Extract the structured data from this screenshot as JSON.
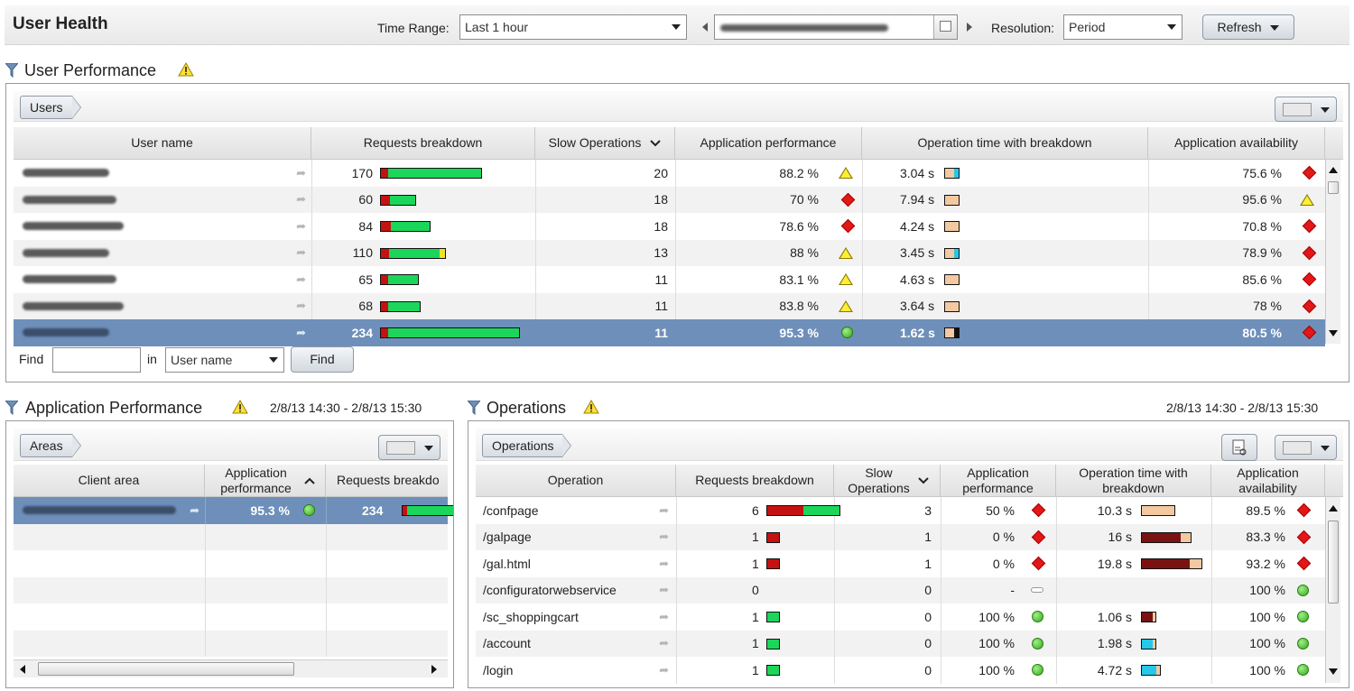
{
  "header": {
    "title": "User Health",
    "time_range_label": "Time Range:",
    "time_range_value": "Last 1 hour",
    "resolution_label": "Resolution:",
    "resolution_value": "Period",
    "refresh_label": "Refresh"
  },
  "user_performance": {
    "title": "User Performance",
    "breadcrumb": "Users",
    "columns": [
      "User name",
      "Requests breakdown",
      "Slow Operations",
      "Application performance",
      "Operation time with breakdown",
      "Application availability"
    ],
    "rows": [
      {
        "requests": "170",
        "req_red": 0.07,
        "req_green": 0.93,
        "req_yellow": 0,
        "slow": "20",
        "perf": "88.2 %",
        "perf_icon": "warning-triangle-icon",
        "optime": "3.04 s",
        "ot": [
          "peach",
          "cyan"
        ],
        "avail": "75.6 %",
        "avail_icon": "red-diamond-icon",
        "bar_total": 170
      },
      {
        "requests": "60",
        "req_red": 0.25,
        "req_green": 0.75,
        "req_yellow": 0,
        "slow": "18",
        "perf": "70 %",
        "perf_icon": "red-diamond-icon",
        "optime": "7.94 s",
        "ot": [
          "peach"
        ],
        "avail": "95.6 %",
        "avail_icon": "warning-triangle-icon",
        "bar_total": 60
      },
      {
        "requests": "84",
        "req_red": 0.2,
        "req_green": 0.8,
        "req_yellow": 0,
        "slow": "18",
        "perf": "78.6 %",
        "perf_icon": "red-diamond-icon",
        "optime": "4.24 s",
        "ot": [
          "peach"
        ],
        "avail": "70.8 %",
        "avail_icon": "red-diamond-icon",
        "bar_total": 84
      },
      {
        "requests": "110",
        "req_red": 0.12,
        "req_green": 0.8,
        "req_yellow": 0.08,
        "slow": "13",
        "perf": "88 %",
        "perf_icon": "warning-triangle-icon",
        "optime": "3.45 s",
        "ot": [
          "peach",
          "cyan"
        ],
        "avail": "78.9 %",
        "avail_icon": "red-diamond-icon",
        "bar_total": 110
      },
      {
        "requests": "65",
        "req_red": 0.2,
        "req_green": 0.8,
        "req_yellow": 0,
        "slow": "11",
        "perf": "83.1 %",
        "perf_icon": "warning-triangle-icon",
        "optime": "4.63 s",
        "ot": [
          "peach"
        ],
        "avail": "85.6 %",
        "avail_icon": "red-diamond-icon",
        "bar_total": 65
      },
      {
        "requests": "68",
        "req_red": 0.18,
        "req_green": 0.82,
        "req_yellow": 0,
        "slow": "11",
        "perf": "83.8 %",
        "perf_icon": "warning-triangle-icon",
        "optime": "3.64 s",
        "ot": [
          "peach"
        ],
        "avail": "78 %",
        "avail_icon": "red-diamond-icon",
        "bar_total": 68
      },
      {
        "requests": "234",
        "req_red": 0.05,
        "req_green": 0.95,
        "req_yellow": 0,
        "slow": "11",
        "perf": "95.3 %",
        "perf_icon": "green-circle-icon",
        "optime": "1.62 s",
        "ot": [
          "peach",
          "dark"
        ],
        "avail": "80.5 %",
        "avail_icon": "red-diamond-icon",
        "bar_total": 234,
        "selected": true
      }
    ],
    "find_label": "Find",
    "find_value": "",
    "in_label": "in",
    "find_field": "User name",
    "find_button": "Find"
  },
  "application_performance": {
    "title": "Application Performance",
    "range": "2/8/13 14:30 - 2/8/13 15:30",
    "breadcrumb": "Areas",
    "columns": [
      "Client area",
      "Application performance",
      "Requests breakdo"
    ],
    "rows": [
      {
        "perf": "95.3 %",
        "requests": "234",
        "selected": true
      }
    ]
  },
  "operations": {
    "title": "Operations",
    "range": "2/8/13 14:30 - 2/8/13 15:30",
    "breadcrumb": "Operations",
    "columns": [
      "Operation",
      "Requests breakdown",
      "Slow Operations",
      "Application performance",
      "Operation time with breakdown",
      "Application availability"
    ],
    "rows": [
      {
        "op": "/confpage",
        "requests": "6",
        "req_red": 0.5,
        "req_green": 0.5,
        "bar_total": 6,
        "slow": "3",
        "perf": "50 %",
        "perf_icon": "red-diamond-icon",
        "optime": "10.3 s",
        "ot": [
          "peach"
        ],
        "ot_w": 34,
        "avail": "89.5 %",
        "avail_icon": "red-diamond-icon"
      },
      {
        "op": "/galpage",
        "requests": "1",
        "req_red": 1,
        "req_green": 0,
        "bar_total": 1,
        "slow": "1",
        "perf": "0 %",
        "perf_icon": "red-diamond-icon",
        "optime": "16 s",
        "ot": [
          "brown"
        ],
        "ot_w": 52,
        "avail": "83.3 %",
        "avail_icon": "red-diamond-icon"
      },
      {
        "op": "/gal.html",
        "requests": "1",
        "req_red": 1,
        "req_green": 0,
        "bar_total": 1,
        "slow": "1",
        "perf": "0 %",
        "perf_icon": "red-diamond-icon",
        "optime": "19.8 s",
        "ot": [
          "brown"
        ],
        "ot_w": 64,
        "avail": "93.2 %",
        "avail_icon": "red-diamond-icon"
      },
      {
        "op": "/configuratorwebservice",
        "requests": "0",
        "req_red": 0,
        "req_green": 0,
        "bar_total": 0,
        "slow": "0",
        "perf": "-",
        "perf_icon": "no-data-dash-icon",
        "optime": "",
        "ot": [],
        "ot_w": 0,
        "avail": "100 %",
        "avail_icon": "green-circle-icon"
      },
      {
        "op": "/sc_shoppingcart",
        "requests": "1",
        "req_red": 0,
        "req_green": 1,
        "bar_total": 1,
        "slow": "0",
        "perf": "100 %",
        "perf_icon": "green-circle-icon",
        "optime": "1.06 s",
        "ot": [
          "brown"
        ],
        "ot_w": 13,
        "avail": "100 %",
        "avail_icon": "green-circle-icon"
      },
      {
        "op": "/account",
        "requests": "1",
        "req_red": 0,
        "req_green": 1,
        "bar_total": 1,
        "slow": "0",
        "perf": "100 %",
        "perf_icon": "green-circle-icon",
        "optime": "1.98 s",
        "ot": [
          "cyan"
        ],
        "ot_w": 13,
        "avail": "100 %",
        "avail_icon": "green-circle-icon"
      },
      {
        "op": "/login",
        "requests": "1",
        "req_red": 0,
        "req_green": 1,
        "bar_total": 1,
        "slow": "0",
        "perf": "100 %",
        "perf_icon": "green-circle-icon",
        "optime": "4.72 s",
        "ot": [
          "cyan"
        ],
        "ot_w": 18,
        "avail": "100 %",
        "avail_icon": "green-circle-icon"
      }
    ]
  }
}
